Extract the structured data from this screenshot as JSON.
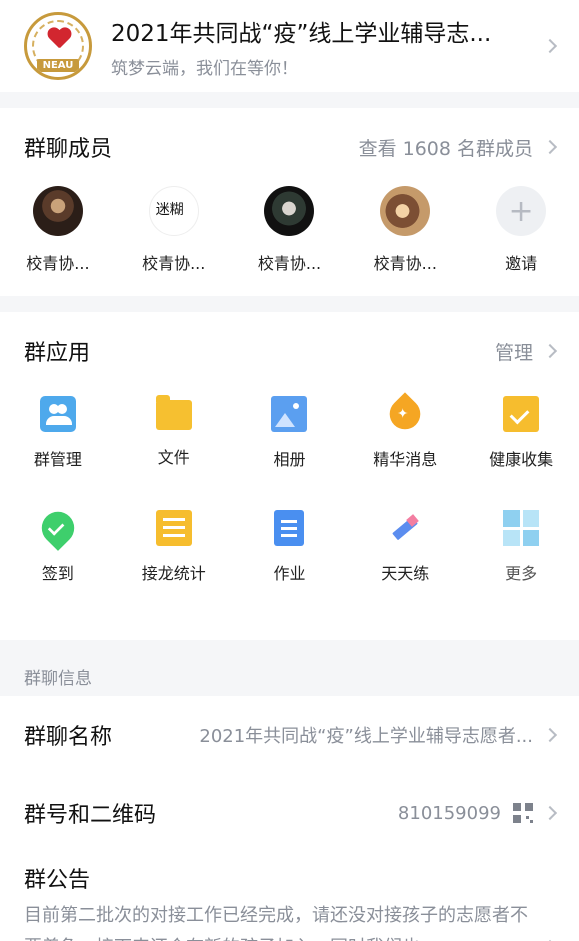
{
  "header": {
    "logo_text": "NEAU",
    "title": "2021年共同战“疫”线上学业辅导志...",
    "subtitle": "筑梦云端，我们在等你！"
  },
  "members": {
    "title": "群聊成员",
    "view_all": "查看 1608 名群成员",
    "list": [
      {
        "name": "校青协..."
      },
      {
        "name": "校青协...",
        "avatar_text": "迷糊"
      },
      {
        "name": "校青协..."
      },
      {
        "name": "校青协..."
      }
    ],
    "invite": {
      "label": "邀请",
      "glyph": "+"
    }
  },
  "apps": {
    "title": "群应用",
    "manage": "管理",
    "items": [
      {
        "label": "群管理",
        "icon": "group-manage-icon"
      },
      {
        "label": "文件",
        "icon": "folder-icon"
      },
      {
        "label": "相册",
        "icon": "album-icon"
      },
      {
        "label": "精华消息",
        "icon": "essence-drop-icon"
      },
      {
        "label": "健康收集",
        "icon": "health-check-icon"
      },
      {
        "label": "签到",
        "icon": "checkin-pin-icon"
      },
      {
        "label": "接龙统计",
        "icon": "chain-list-icon"
      },
      {
        "label": "作业",
        "icon": "homework-doc-icon"
      },
      {
        "label": "天天练",
        "icon": "pencil-icon"
      },
      {
        "label": "更多",
        "icon": "more-grid-icon"
      }
    ]
  },
  "info": {
    "section_label": "群聊信息",
    "name_key": "群聊名称",
    "name_value": "2021年共同战“疫”线上学业辅导志愿者...",
    "number_key": "群号和二维码",
    "number_value": "810159099",
    "notice_key": "群公告",
    "notice_text": "目前第二批次的对接工作已经完成，请还没对接孩子的志愿者不要着急，接下来还会有新的孩子加入，同时我们也"
  }
}
